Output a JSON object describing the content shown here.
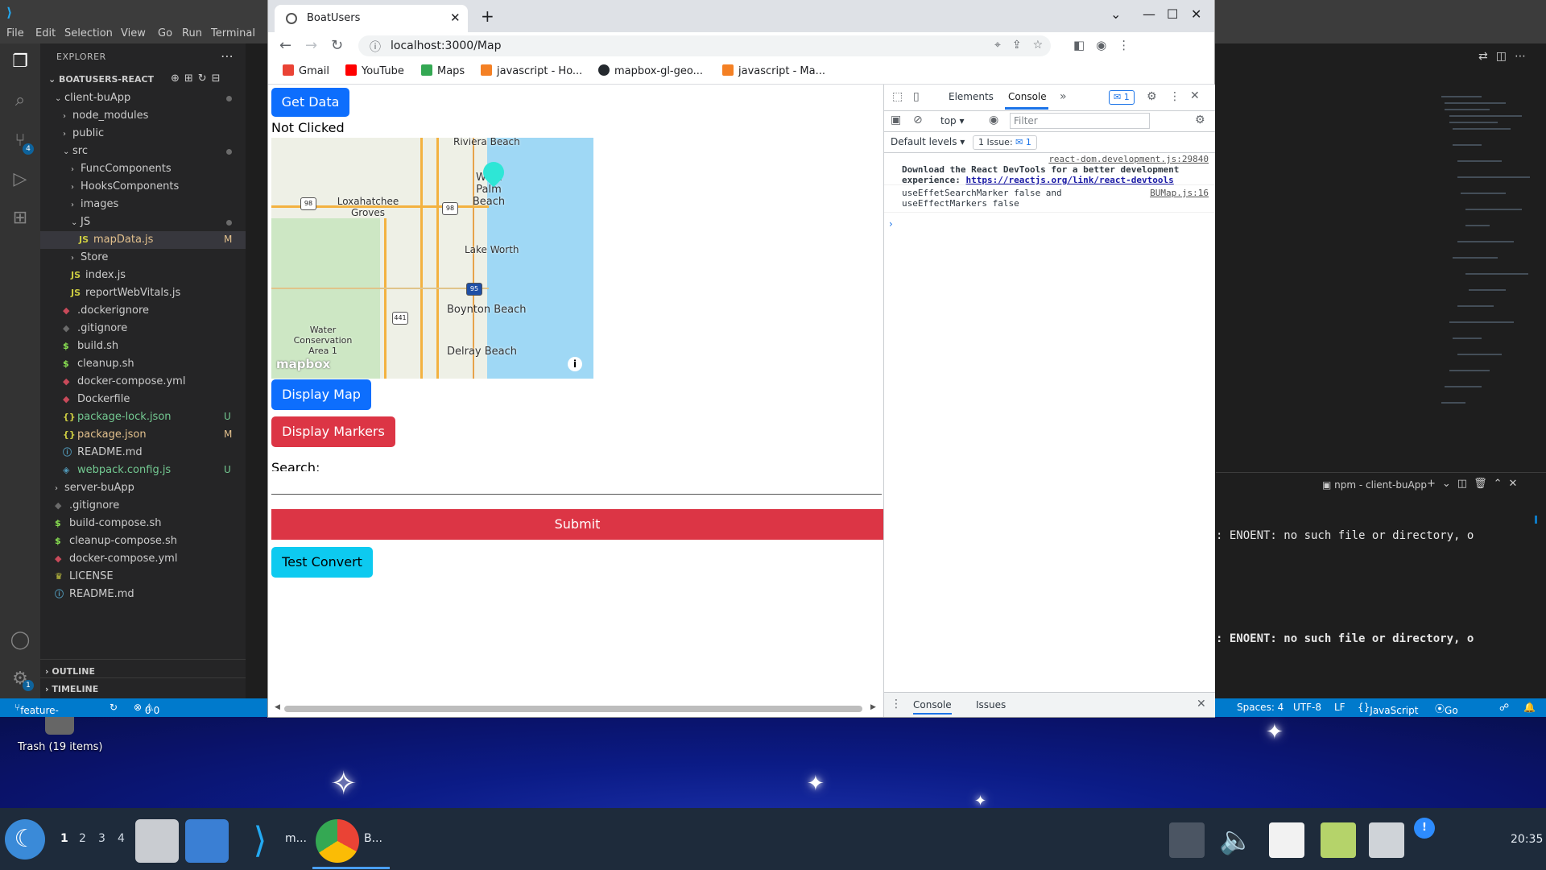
{
  "desktop": {
    "trash_label": "Trash (19 items)"
  },
  "taskbar": {
    "workspaces": [
      "1",
      "2",
      "3",
      "4"
    ],
    "vscode_label": "m...",
    "chrome_label": "B...",
    "clock": "20:35"
  },
  "vscode": {
    "menu": [
      "File",
      "Edit",
      "Selection",
      "View",
      "Go",
      "Run",
      "Terminal"
    ],
    "explorer_title": "EXPLORER",
    "root": "BOATUSERS-REACT",
    "scm_badge": "4",
    "settings_badge": "1",
    "tree": [
      {
        "label": "client-buApp",
        "kind": "folder-open",
        "indent": 0
      },
      {
        "label": "node_modules",
        "kind": "folder",
        "indent": 1
      },
      {
        "label": "public",
        "kind": "folder",
        "indent": 1
      },
      {
        "label": "src",
        "kind": "folder-open",
        "indent": 1
      },
      {
        "label": "FuncComponents",
        "kind": "folder",
        "indent": 2
      },
      {
        "label": "HooksComponents",
        "kind": "folder",
        "indent": 2
      },
      {
        "label": "images",
        "kind": "folder",
        "indent": 2
      },
      {
        "label": "JS",
        "kind": "folder-open",
        "indent": 2
      },
      {
        "label": "mapData.js",
        "kind": "js",
        "indent": 3,
        "badge": "M"
      },
      {
        "label": "Store",
        "kind": "folder",
        "indent": 2
      },
      {
        "label": "index.js",
        "kind": "js",
        "indent": 2
      },
      {
        "label": "reportWebVitals.js",
        "kind": "js",
        "indent": 2
      },
      {
        "label": ".dockerignore",
        "kind": "docker",
        "indent": 1
      },
      {
        "label": ".gitignore",
        "kind": "git",
        "indent": 1
      },
      {
        "label": "build.sh",
        "kind": "sh",
        "indent": 1
      },
      {
        "label": "cleanup.sh",
        "kind": "sh",
        "indent": 1
      },
      {
        "label": "docker-compose.yml",
        "kind": "docker",
        "indent": 1
      },
      {
        "label": "Dockerfile",
        "kind": "docker",
        "indent": 1
      },
      {
        "label": "package-lock.json",
        "kind": "json",
        "indent": 1,
        "badge": "U"
      },
      {
        "label": "package.json",
        "kind": "json",
        "indent": 1,
        "badge": "M"
      },
      {
        "label": "README.md",
        "kind": "md",
        "indent": 1
      },
      {
        "label": "webpack.config.js",
        "kind": "webpack",
        "indent": 1,
        "badge": "U"
      },
      {
        "label": "server-buApp",
        "kind": "folder",
        "indent": 0
      },
      {
        "label": ".gitignore",
        "kind": "git",
        "indent": 0
      },
      {
        "label": "build-compose.sh",
        "kind": "sh",
        "indent": 0
      },
      {
        "label": "cleanup-compose.sh",
        "kind": "sh",
        "indent": 0
      },
      {
        "label": "docker-compose.yml",
        "kind": "docker",
        "indent": 0
      },
      {
        "label": "LICENSE",
        "kind": "license",
        "indent": 0
      },
      {
        "label": "README.md",
        "kind": "md",
        "indent": 0
      }
    ],
    "outline": "OUTLINE",
    "timeline": "TIMELINE",
    "status": {
      "branch": "feature-three*",
      "problems": "0",
      "warnings": "0",
      "spaces": "Spaces: 4",
      "encoding": "UTF-8",
      "eol": "LF",
      "language": "JavaScript",
      "golive": "Go Live"
    },
    "terminal_name": "npm - client-buApp",
    "terminal_lines": [
      ": ENOENT: no such file or directory, o",
      ": ENOENT: no such file or directory, o"
    ]
  },
  "chrome": {
    "tab_title": "BoatUsers",
    "url": "localhost:3000/Map",
    "bookmarks": [
      "Gmail",
      "YouTube",
      "Maps",
      "javascript - Ho...",
      "mapbox-gl-geo...",
      "javascript - Ma..."
    ]
  },
  "page": {
    "get_data": "Get Data",
    "status_text": "Not Clicked",
    "display_map": "Display Map",
    "display_markers": "Display Markers",
    "search_label": "Search:",
    "submit": "Submit",
    "test_convert": "Test Convert",
    "map": {
      "places": [
        "Riviera Beach",
        "West Palm Beach",
        "Loxahatchee Groves",
        "Lake Worth",
        "Boynton Beach",
        "Water Conservation Area 1",
        "Delray Beach"
      ],
      "shields": [
        "98",
        "98",
        "95",
        "441"
      ],
      "logo": "mapbox"
    }
  },
  "devtools": {
    "tabs": [
      "Elements",
      "Console"
    ],
    "message_badge": "1",
    "context": "top",
    "filter_placeholder": "Filter",
    "levels": "Default levels",
    "issues": "1 Issue:",
    "issues_count": "1",
    "logs": [
      {
        "source": "react-dom.development.js:29840",
        "text": "Download the React DevTools for a better development experience: ",
        "link": "https://reactjs.org/link/react-devtools"
      },
      {
        "source": "BUMap.js:16",
        "text": "useEffetSearchMarker false and useEffectMarkers false"
      }
    ],
    "drawer_tabs": [
      "Console",
      "Issues"
    ]
  }
}
